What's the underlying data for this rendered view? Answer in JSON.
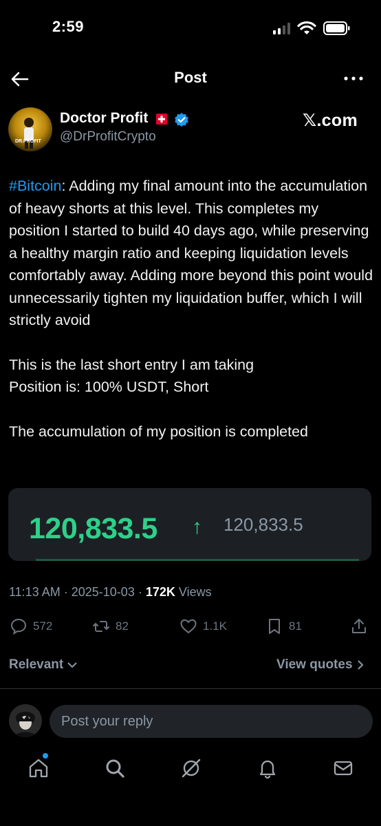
{
  "status_bar": {
    "time": "2:59"
  },
  "topbar": {
    "title": "Post"
  },
  "post": {
    "author": "Doctor Profit",
    "handle": "@DrProfitCrypto",
    "source_label": "𝕏.com",
    "avatar_text": "DR.PROFIT",
    "hashtag": "#Bitcoin",
    "paragraph1_rest": ": Adding my final amount into the accumulation of heavy shorts at this level. This completes my position I started to build 40 days ago, while preserving a healthy margin ratio and keeping liquidation levels comfortably away. Adding more beyond this point would unnecessarily tighten my liquidation buffer, which I will strictly avoid",
    "paragraph2_line1": "This is the last short entry I am taking",
    "paragraph2_line2": "Position is: 100% USDT, Short",
    "paragraph3": "The accumulation of my position is completed",
    "price_main": "120,833.5",
    "price_arrow": "↑",
    "price_secondary": "120,833.5",
    "time": "11:13 AM",
    "date": "2025-10-03",
    "views_count": "172K",
    "views_label": "Views",
    "sep": "·"
  },
  "actions": {
    "replies": "572",
    "reposts": "82",
    "likes": "1.1K",
    "bookmarks": "81"
  },
  "replies_bar": {
    "sort_label": "Relevant",
    "view_quotes": "View quotes"
  },
  "reply": {
    "placeholder": "Post your reply"
  },
  "colors": {
    "accent": "#1d9bf0",
    "price_green": "#2ed08a",
    "background": "#000000"
  },
  "icons": [
    "back-arrow-icon",
    "more-icon",
    "verified-icon",
    "reply-icon",
    "repost-icon",
    "like-icon",
    "bookmark-icon",
    "share-icon",
    "home-icon",
    "search-icon",
    "grok-icon",
    "bell-icon",
    "mail-icon"
  ]
}
